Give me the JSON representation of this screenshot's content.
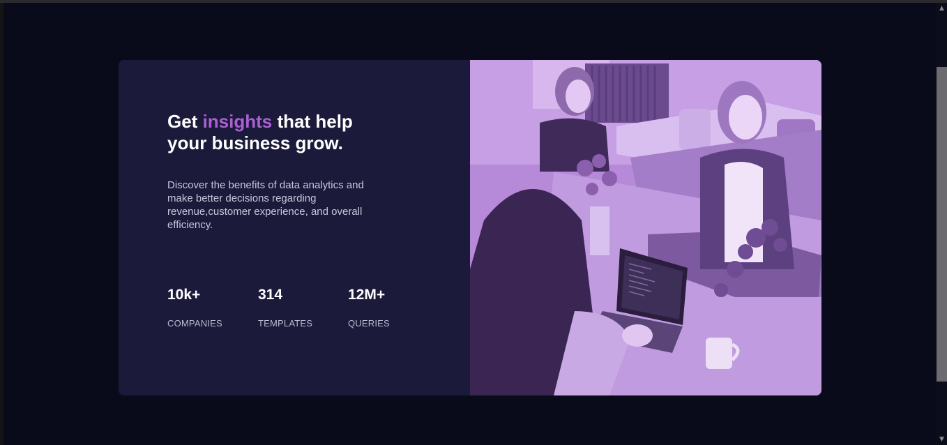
{
  "card": {
    "headline_part1": "Get ",
    "headline_accent": "insights",
    "headline_part2": " that help your business grow.",
    "description": "Discover the benefits of data analytics and make better decisions regarding revenue,customer experience, and overall efficiency.",
    "stats": [
      {
        "value": "10k+",
        "label": "COMPANIES"
      },
      {
        "value": "314",
        "label": "TEMPLATES"
      },
      {
        "value": "12M+",
        "label": "QUERIES"
      }
    ],
    "image_icon": "office-photo-image"
  },
  "colors": {
    "page_background": "#090b1a",
    "card_background": "#1c1a3a",
    "accent": "#a960d0",
    "image_tint": "#b98ddb"
  },
  "scrollbar": {
    "up_icon": "chevron-up-icon",
    "down_icon": "chevron-down-icon"
  }
}
